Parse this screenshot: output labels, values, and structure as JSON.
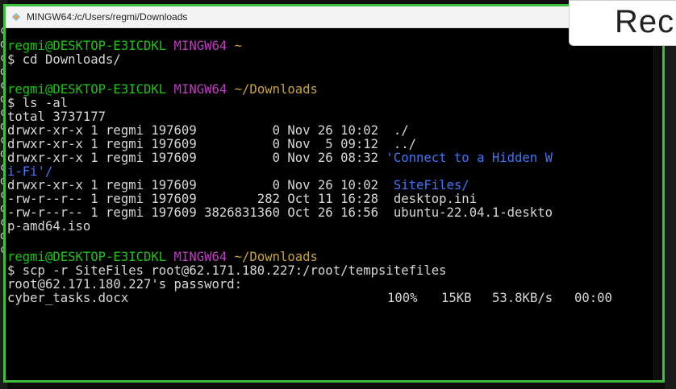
{
  "window": {
    "title": "MINGW64:/c/Users/regmi/Downloads",
    "icon": "mingw-terminal-icon"
  },
  "overlay": {
    "rec_label": "Rec"
  },
  "colors": {
    "prompt_user": "#16c60c",
    "prompt_shell": "#c239c2",
    "prompt_path": "#c8a43a",
    "directory": "#3b78ff",
    "text": "#d7d7d7",
    "frame_border": "#3fbd3f"
  },
  "left_strip_glyphs": [
    "c",
    "d",
    "c",
    "d",
    "c",
    "d",
    "c",
    "d",
    "c",
    "d",
    "c",
    "d",
    "c",
    "d",
    "c",
    "d",
    "c"
  ],
  "terminal": {
    "prompt1": {
      "user": "regmi@DESKTOP-E3ICDKL",
      "shell": "MINGW64",
      "path": "~"
    },
    "cmd1": "$ cd Downloads/",
    "prompt2": {
      "user": "regmi@DESKTOP-E3ICDKL",
      "shell": "MINGW64",
      "path": "~/Downloads"
    },
    "cmd2": "$ ls -al",
    "total": "total 3737177",
    "listing": [
      {
        "meta": "drwxr-xr-x 1 regmi 197609          0 Nov 26 10:02  ",
        "name": "./",
        "dir": false
      },
      {
        "meta": "drwxr-xr-x 1 regmi 197609          0 Nov  5 09:12  ",
        "name": "../",
        "dir": false
      },
      {
        "meta": "drwxr-xr-x 1 regmi 197609          0 Nov 26 08:32 ",
        "name": "'Connect to a Hidden W",
        "dir": true
      },
      {
        "meta": "",
        "name": "i-Fi'/",
        "dir": true,
        "wrap": true
      },
      {
        "meta": "drwxr-xr-x 1 regmi 197609          0 Nov 26 10:02  ",
        "name": "SiteFiles/",
        "dir": true
      },
      {
        "meta": "-rw-r--r-- 1 regmi 197609        282 Oct 11 16:28  ",
        "name": "desktop.ini",
        "dir": false
      },
      {
        "meta": "-rw-r--r-- 1 regmi 197609 3826831360 Oct 26 16:56  ",
        "name": "ubuntu-22.04.1-deskto",
        "dir": false
      },
      {
        "meta": "",
        "name": "p-amd64.iso",
        "dir": false,
        "wrap": true
      }
    ],
    "prompt3": {
      "user": "regmi@DESKTOP-E3ICDKL",
      "shell": "MINGW64",
      "path": "~/Downloads"
    },
    "cmd3": "$ scp -r SiteFiles root@62.171.180.227:/root/tempsitefiles",
    "password_prompt": "root@62.171.180.227's password:",
    "transfer": {
      "file": "cyber_tasks.docx",
      "percent": "100%",
      "size": "15KB",
      "rate": "53.8KB/s",
      "eta": "00:00"
    }
  }
}
